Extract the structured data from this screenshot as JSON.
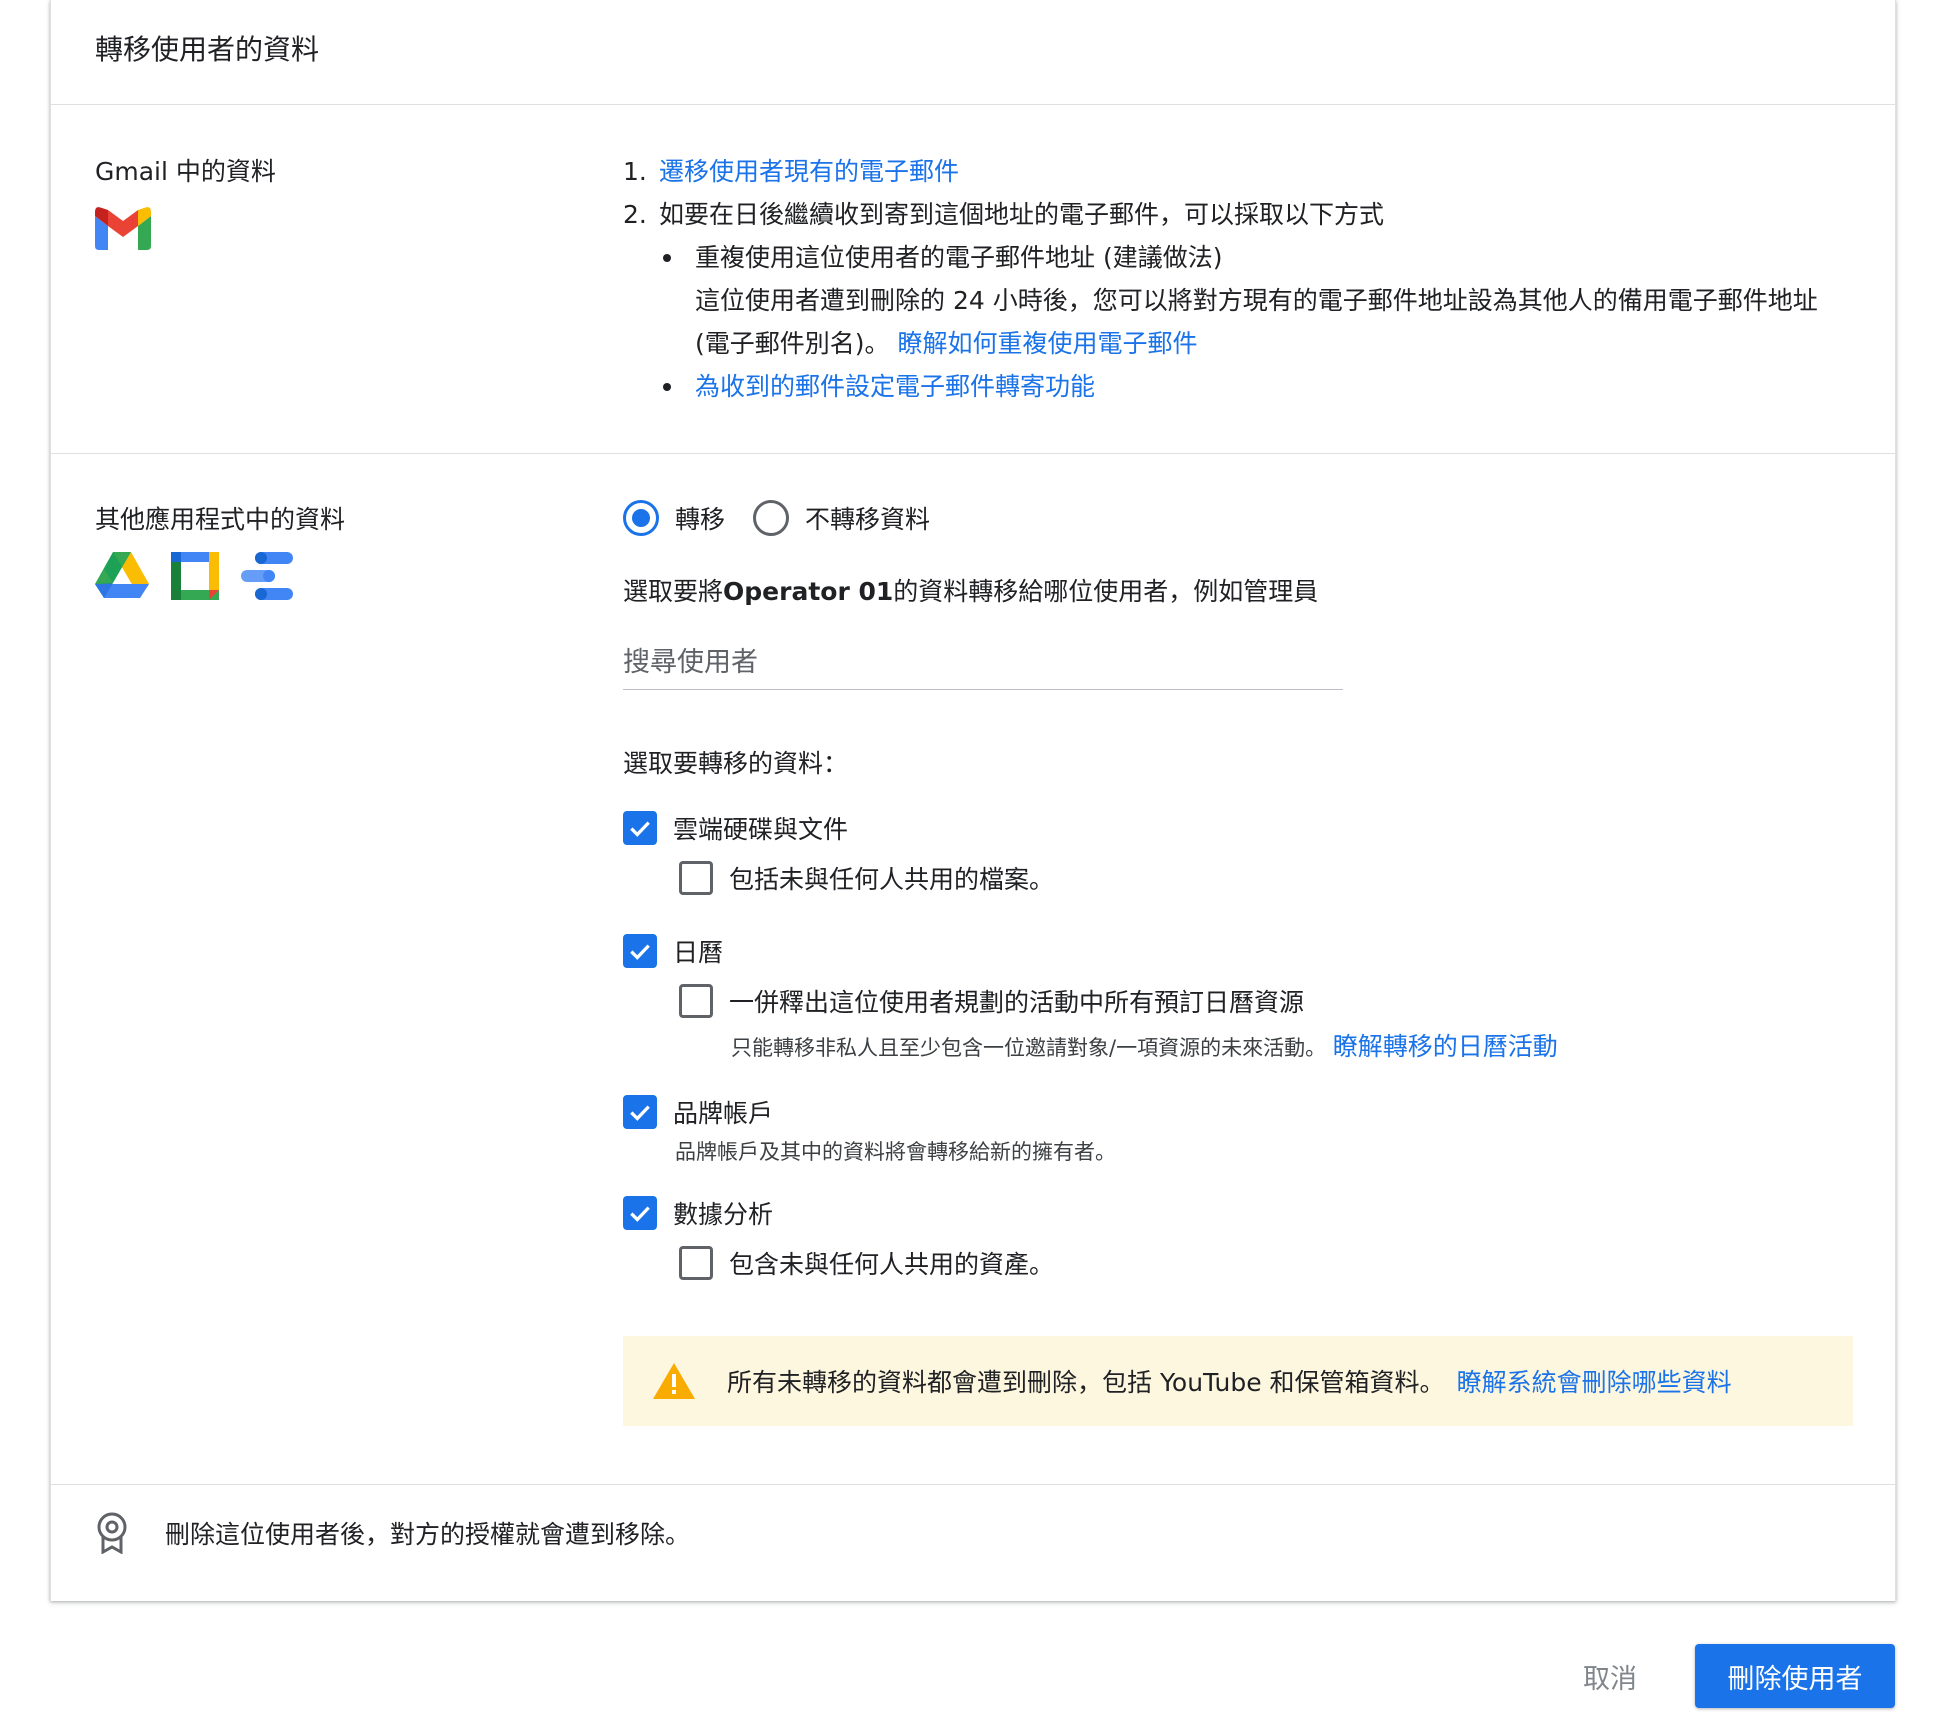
{
  "dialog": {
    "title": "轉移使用者的資料"
  },
  "gmail_section": {
    "label": "Gmail 中的資料",
    "icon": "gmail-icon",
    "steps": [
      {
        "num": "1.",
        "link": "遷移使用者現有的電子郵件"
      },
      {
        "num": "2.",
        "text": "如要在日後繼續收到寄到這個地址的電子郵件，可以採取以下方式"
      }
    ],
    "bullets": {
      "reuse_title": "重複使用這位使用者的電子郵件地址 (建議做法)",
      "reuse_desc_1": "這位使用者遭到刪除的 24 小時後，您可以將對方現有的電子郵件地址設為其他人的備用電子郵件地址",
      "reuse_desc_2": "(電子郵件別名)。",
      "reuse_link": "瞭解如何重複使用電子郵件",
      "forward_link": "為收到的郵件設定電子郵件轉寄功能"
    }
  },
  "other_apps_section": {
    "label": "其他應用程式中的資料",
    "icons": [
      "drive-icon",
      "calendar-icon",
      "data-studio-icon"
    ],
    "radio": {
      "transfer_label": "轉移",
      "no_transfer_label": "不轉移資料",
      "selected": "transfer"
    },
    "select_user_prompt_prefix": "選取要將",
    "select_user_name": "Operator 01",
    "select_user_prompt_suffix": "的資料轉移給哪位使用者，例如管理員",
    "search_placeholder": "搜尋使用者",
    "select_data_prompt": "選取要轉移的資料：",
    "options": {
      "drive": {
        "label": "雲端硬碟與文件",
        "checked": true
      },
      "drive_unshared": {
        "label": "包括未與任何人共用的檔案。",
        "checked": false
      },
      "calendar": {
        "label": "日曆",
        "checked": true
      },
      "calendar_release": {
        "label": "一併釋出這位使用者規劃的活動中所有預訂日曆資源",
        "checked": false
      },
      "calendar_helper": "只能轉移非私人且至少包含一位邀請對象/一項資源的未來活動。",
      "calendar_link": "瞭解轉移的日曆活動",
      "brand": {
        "label": "品牌帳戶",
        "checked": true
      },
      "brand_helper": "品牌帳戶及其中的資料將會轉移給新的擁有者。",
      "analytics": {
        "label": "數據分析",
        "checked": true
      },
      "analytics_unshared": {
        "label": "包含未與任何人共用的資產。",
        "checked": false
      }
    },
    "warning": {
      "icon": "warning-icon",
      "text": "所有未轉移的資料都會遭到刪除，包括 YouTube 和保管箱資料。",
      "link": "瞭解系統會刪除哪些資料"
    }
  },
  "footer_note": {
    "icon": "license-badge-icon",
    "text": "刪除這位使用者後，對方的授權就會遭到移除。"
  },
  "actions": {
    "cancel_label": "取消",
    "delete_label": "刪除使用者"
  },
  "colors": {
    "accent": "#1a73e8",
    "warning_bg": "#fef7e0",
    "warning_icon": "#f9ab00"
  }
}
